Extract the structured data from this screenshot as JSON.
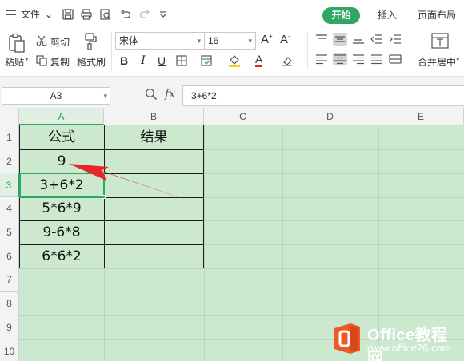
{
  "menu": {
    "file": "文件",
    "tabs": {
      "start": "开始",
      "insert": "插入",
      "layout": "页面布局"
    }
  },
  "ribbon": {
    "paste": "粘贴",
    "cut": "剪切",
    "copy": "复制",
    "format_painter": "格式刷",
    "font_name": "宋体",
    "font_size": "16",
    "merge": "合并居中"
  },
  "formula_bar": {
    "name_box": "A3",
    "fx": "fx",
    "formula": "3+6*2"
  },
  "grid": {
    "columns": [
      "A",
      "B",
      "C",
      "D",
      "E"
    ],
    "rows": [
      "1",
      "2",
      "3",
      "4",
      "5",
      "6",
      "7",
      "8",
      "9",
      "10"
    ],
    "active_column": "A",
    "active_row": "3",
    "cells": {
      "A1": "公式",
      "B1": "结果",
      "A2": "9",
      "A3": "3+6*2",
      "A4": "5*6*9",
      "A5": "9-6*8",
      "A6": "6*6*2"
    }
  },
  "watermark": {
    "title": "Office教程网",
    "url": "www.office26.com"
  },
  "colors": {
    "accent": "#2ea664",
    "sheet_bg": "#cce8cf",
    "arrow": "#e8262a",
    "logo": "#ef5a24"
  }
}
